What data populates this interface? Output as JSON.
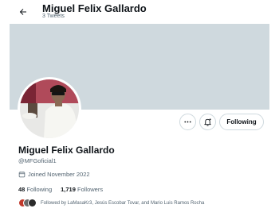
{
  "header": {
    "title": "Miguel Felix Gallardo",
    "subtitle": "3 Tweets"
  },
  "profile": {
    "display_name": "Miguel Felix Gallardo",
    "handle": "@MFGoficial1",
    "joined": "Joined November 2022",
    "following_count": "48",
    "following_label": "Following",
    "followers_count": "1,719",
    "followers_label": "Followers",
    "followed_by": "Followed by LaMasaKr3, Jesús Escobar Tovar, and Mario Luis Ramos Rocha"
  },
  "actions": {
    "follow_label": "Following"
  },
  "icons": {
    "back": "arrow-left-icon",
    "more": "more-icon",
    "notify": "notification-bell-icon",
    "joined": "calendar-icon"
  },
  "colors": {
    "banner": "#cfd9de",
    "secondary_text": "#536471",
    "border": "#cfd9de"
  }
}
